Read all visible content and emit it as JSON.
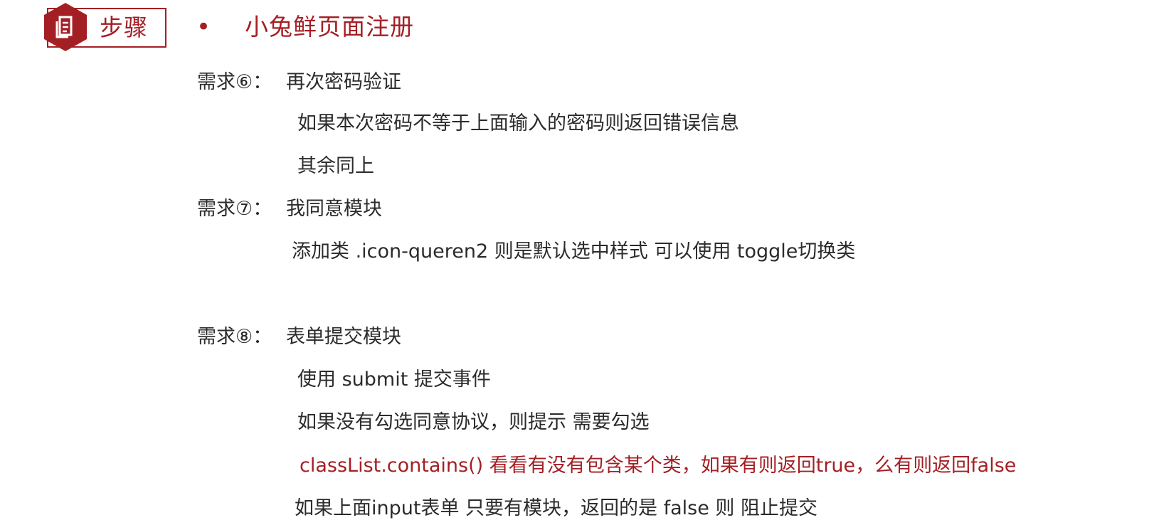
{
  "header": {
    "badge_label": "步骤",
    "badge_icon": "document-icon",
    "bullet": "•",
    "title": "小兔鲜页面注册"
  },
  "requirements": [
    {
      "prefix": "需求⑥：",
      "title": "再次密码验证",
      "details": [
        "如果本次密码不等于上面输入的密码则返回错误信息",
        "其余同上"
      ]
    },
    {
      "prefix": "需求⑦：",
      "title": "我同意模块",
      "details": [
        "添加类  .icon-queren2  则是默认选中样式  可以使用 toggle切换类"
      ]
    },
    {
      "prefix": "需求⑧：",
      "title": "表单提交模块",
      "details": [
        "使用 submit 提交事件",
        "如果没有勾选同意协议，则提示  需要勾选",
        "classList.contains() 看看有没有包含某个类，如果有则返回true，么有则返回false",
        "如果上面input表单 只要有模块，返回的是 false 则 阻止提交"
      ]
    }
  ],
  "colors": {
    "accent": "#a41f24",
    "text": "#2b2b2b"
  }
}
